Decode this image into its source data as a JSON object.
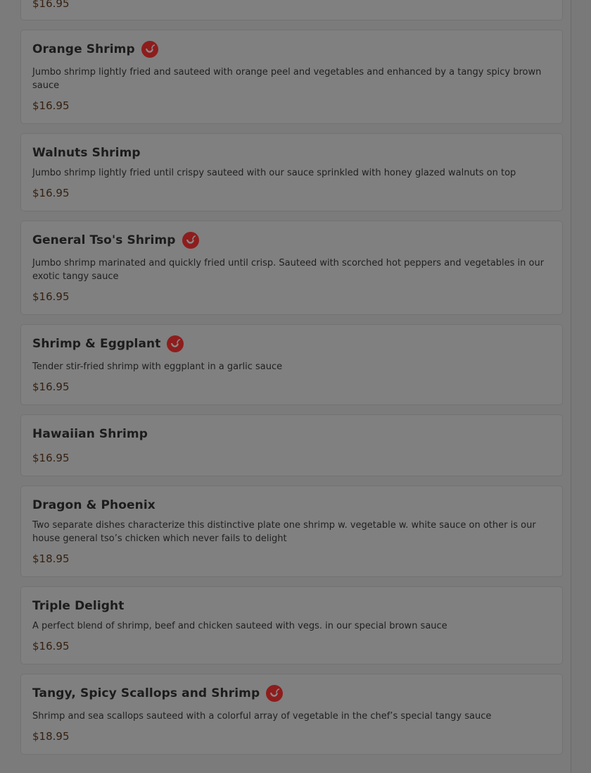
{
  "menu": {
    "items": [
      {
        "name": "",
        "description": "",
        "price": "$16.95",
        "spicy": false
      },
      {
        "name": "Orange Shrimp",
        "description": "Jumbo shrimp lightly fried and sauteed with orange peel and vegetables and enhanced by a tangy spicy brown sauce",
        "price": "$16.95",
        "spicy": true
      },
      {
        "name": "Walnuts Shrimp",
        "description": "Jumbo shrimp lightly fried until crispy sauteed with our sauce sprinkled with honey glazed walnuts on top",
        "price": "$16.95",
        "spicy": false
      },
      {
        "name": "General Tso's Shrimp",
        "description": "Jumbo shrimp marinated and quickly fried until crisp. Sauteed with scorched hot peppers and vegetables in our exotic tangy sauce",
        "price": "$16.95",
        "spicy": true
      },
      {
        "name": "Shrimp & Eggplant",
        "description": "Tender stir-fried shrimp with eggplant in a garlic sauce",
        "price": "$16.95",
        "spicy": true
      },
      {
        "name": "Hawaiian Shrimp",
        "description": "",
        "price": "$16.95",
        "spicy": false
      },
      {
        "name": "Dragon & Phoenix",
        "description": "Two separate dishes characterize this distinctive plate one shrimp w. vegetable w. white sauce on other is our house general tso’s chicken which never fails to delight",
        "price": "$18.95",
        "spicy": false
      },
      {
        "name": "Triple Delight",
        "description": "A perfect blend of shrimp, beef and chicken sauteed with vegs. in our special brown sauce",
        "price": "$16.95",
        "spicy": false
      },
      {
        "name": "Tangy, Spicy Scallops and Shrimp",
        "description": "Shrimp and sea scallops sauteed with a colorful array of vegetable in the chef’s special tangy sauce",
        "price": "$18.95",
        "spicy": true
      }
    ]
  },
  "icons": {
    "spicy": "chili-pepper-icon"
  },
  "colors": {
    "spicy_bg": "#8e1d1d",
    "price": "#352010",
    "overlay": "#808080"
  }
}
